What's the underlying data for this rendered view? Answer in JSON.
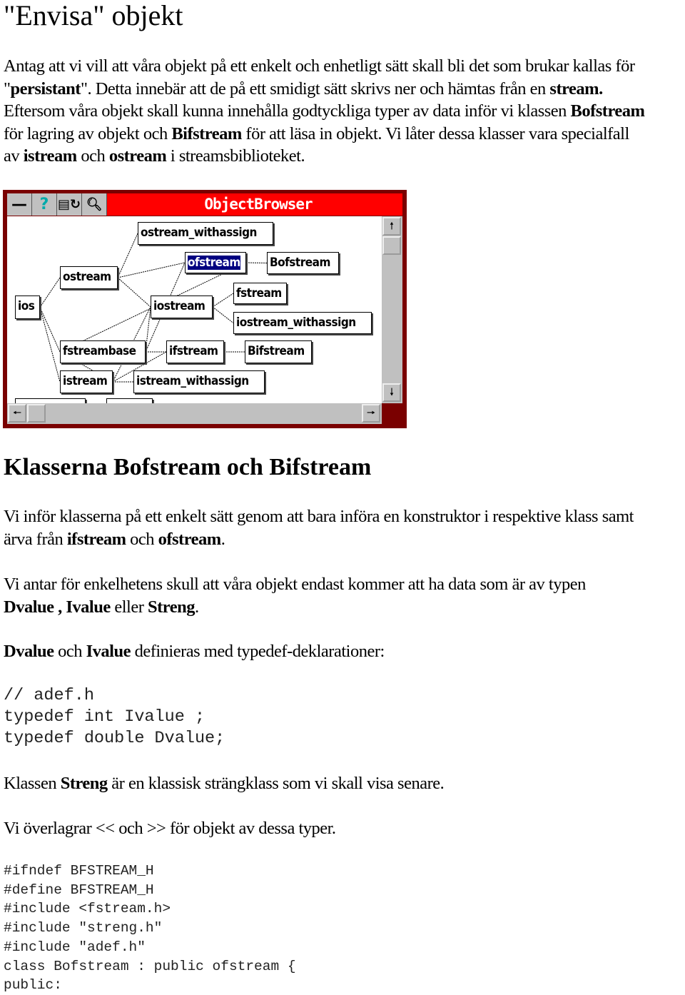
{
  "title": "\"Envisa\" objekt",
  "intro": [
    [
      {
        "t": "Antag att vi vill att våra objekt på ett enkelt och enhetligt sätt skall bli det som brukar kallas för"
      }
    ],
    [
      {
        "t": "\""
      },
      {
        "b": "persistant"
      },
      {
        "t": "\". Detta innebär att de på ett smidigt sätt skrivs ner och hämtas från en "
      },
      {
        "b": "stream."
      }
    ],
    [
      {
        "t": "Eftersom våra objekt skall kunna innehålla godtyckliga typer av data inför vi klassen "
      },
      {
        "b": "Bofstream"
      }
    ],
    [
      {
        "t": "för lagring av objekt och "
      },
      {
        "b": "Bifstream"
      },
      {
        "t": " för att läsa in objekt. Vi låter dessa klasser vara specialfall"
      }
    ],
    [
      {
        "t": "av "
      },
      {
        "b": "istream"
      },
      {
        "t": " och "
      },
      {
        "b": "ostream"
      },
      {
        "t": "  i streamsbiblioteket."
      }
    ]
  ],
  "browser": {
    "title": "ObjectBrowser",
    "toolbar_icons": [
      "minimize-icon",
      "help-icon",
      "document-refresh-icon",
      "magnifier-icon"
    ],
    "nodes": [
      "ostream_withassign",
      "ofstream",
      "Bofstream",
      "ostream",
      "fstream",
      "ios",
      "iostream",
      "iostream_withassign",
      "fstreambase",
      "ifstream",
      "Bifstream",
      "istream",
      "istream_withassign"
    ],
    "selected": "ofstream",
    "titlebar_color": "#ff0000",
    "selection_color": "#000080"
  },
  "heading": "Klasserna Bofstream och Bifstream",
  "paras": [
    [
      [
        {
          "t": "Vi inför klasserna på ett enkelt sätt genom att bara införa en konstruktor i respektive klass samt"
        }
      ],
      [
        {
          "t": "ärva från "
        },
        {
          "b": "ifstream"
        },
        {
          "t": " och "
        },
        {
          "b": "ofstream"
        },
        {
          "t": "."
        }
      ]
    ],
    [
      [
        {
          "t": "Vi antar för enkelhetens skull att våra objekt endast kommer att ha data som är av typen"
        }
      ],
      [
        {
          "b": "Dvalue , Ivalue"
        },
        {
          "t": " eller "
        },
        {
          "b": "Streng"
        },
        {
          "t": "."
        }
      ]
    ],
    [
      [
        {
          "b": "Dvalue"
        },
        {
          "t": " och  "
        },
        {
          "b": "Ivalue"
        },
        {
          "t": " definieras med typedef-deklarationer:"
        }
      ]
    ]
  ],
  "code1": "// adef.h\ntypedef int Ivalue ;\ntypedef double Dvalue;",
  "para_streng": [
    {
      "t": "Klassen "
    },
    {
      "b": "Streng"
    },
    {
      "t": " är en klassisk strängklass som vi skall visa senare."
    }
  ],
  "para_overlagrar": [
    {
      "t": "Vi överlagrar << och >> för objekt av dessa typer."
    }
  ],
  "code2": "#ifndef BFSTREAM_H\n#define BFSTREAM_H\n#include <fstream.h>\n#include \"streng.h\"\n#include \"adef.h\"\nclass Bofstream : public ofstream {\npublic:"
}
